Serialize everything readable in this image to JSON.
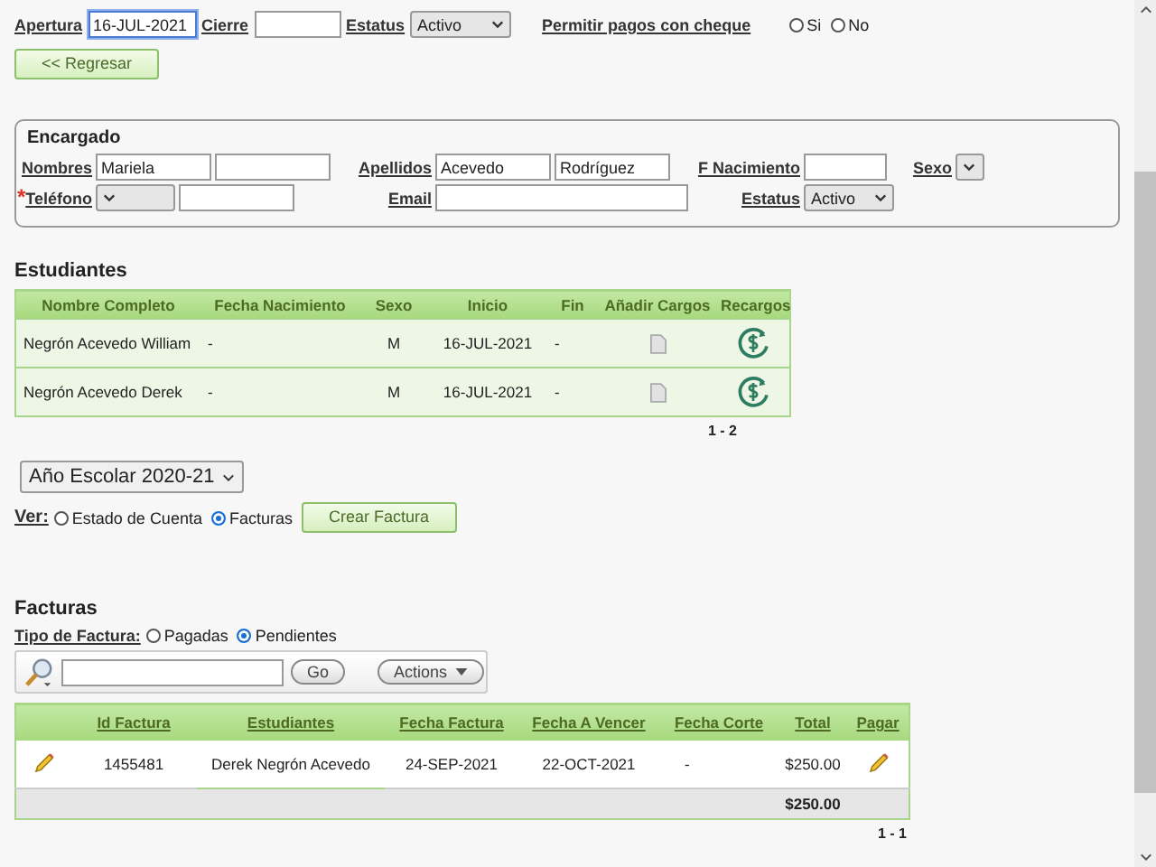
{
  "account": {
    "apertura": {
      "label": "Apertura",
      "value": "16-JUL-2021"
    },
    "cierre": {
      "label": "Cierre"
    },
    "estatus": {
      "label": "Estatus",
      "value": "Activo"
    },
    "cheque": {
      "label": "Permitir pagos con cheque",
      "options": [
        {
          "label": "Si",
          "selected": false
        },
        {
          "label": "No",
          "selected": false
        }
      ]
    }
  },
  "back_button": "<< Regresar",
  "encargado": {
    "title": "Encargado",
    "rows": [
      [
        {
          "label": "Nombres",
          "inputs": [
            {
              "kind": "text",
              "value": "Mariela"
            },
            {
              "kind": "text"
            }
          ]
        },
        {
          "label": "Apellidos",
          "inputs": [
            {
              "kind": "text",
              "value": "Acevedo"
            },
            {
              "kind": "text",
              "value": "Rodríguez"
            }
          ]
        },
        {
          "label": "F Nacimiento",
          "inputs": [
            {
              "kind": "text"
            }
          ]
        },
        {
          "label": "Sexo",
          "inputs": [
            {
              "kind": "select"
            }
          ]
        }
      ],
      [
        {
          "label": "Teléfono",
          "required_mark": "*",
          "inputs": [
            {
              "kind": "select"
            },
            {
              "kind": "text"
            }
          ]
        },
        {
          "label": "Email",
          "inputs": [
            {
              "kind": "wide"
            }
          ]
        },
        {
          "label": "Estatus",
          "inputs": [
            {
              "kind": "select",
              "value": "Activo"
            }
          ]
        }
      ]
    ]
  },
  "students": {
    "title": "Estudiantes",
    "columns": [
      "Nombre Completo",
      "Fecha Nacimiento",
      "Sexo",
      "Inicio",
      "Fin",
      "Añadir Cargos",
      "Recargos"
    ],
    "rows": [
      {
        "cells": [
          "Negrón Acevedo William",
          "-",
          "M",
          "16-JUL-2021",
          "-"
        ]
      },
      {
        "cells": [
          "Negrón Acevedo Derek",
          "-",
          "M",
          "16-JUL-2021",
          "-"
        ]
      }
    ],
    "pager": "1 - 2"
  },
  "year_select": "Año Escolar 2020-21",
  "view": {
    "label": "Ver:",
    "options": [
      {
        "label": "Estado de Cuenta",
        "selected": false
      },
      {
        "label": "Facturas",
        "selected": true
      }
    ],
    "button": "Crear Factura"
  },
  "invoices": {
    "title": "Facturas",
    "type_label": "Tipo de Factura:",
    "type_options": [
      {
        "label": "Pagadas",
        "selected": false
      },
      {
        "label": "Pendientes",
        "selected": true
      }
    ],
    "toolbar": {
      "go": "Go",
      "actions": "Actions"
    },
    "columns": [
      "Id Factura",
      "Estudiantes",
      "Fecha Factura",
      "Fecha A Vencer",
      "Fecha Corte",
      "Total",
      "Pagar"
    ],
    "rows": [
      {
        "cells": [
          "1455481",
          "Derek Negrón Acevedo",
          "24-SEP-2021",
          "22-OCT-2021",
          "-",
          "$250.00"
        ]
      }
    ],
    "total": "$250.00",
    "pager": "1 - 1"
  }
}
